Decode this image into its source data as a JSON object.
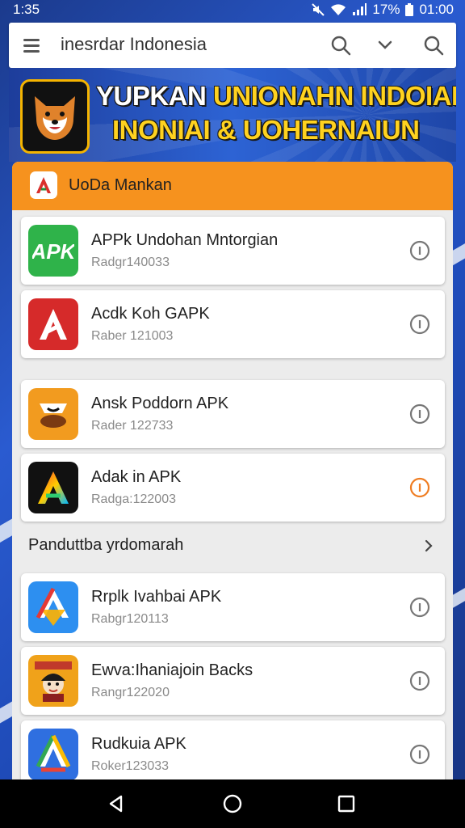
{
  "status_bar": {
    "time": "1:35",
    "battery": "17%",
    "clock_right": "01:00"
  },
  "search": {
    "query": "inesrdar Indonesia"
  },
  "banner": {
    "line1_white": "YUPKAN",
    "line1_yellow": "UNIONAHN INDOIAN",
    "line2": "INONIAI & UOHERNAIUN"
  },
  "panel": {
    "title": "UoDa Mankan"
  },
  "apps_top": [
    {
      "name": "APPk Undohan Mntorgian",
      "sub": "Radgr140033",
      "icon": "apk-green-icon"
    },
    {
      "name": "Acdk Koh GAPK",
      "sub": "Raber 121003",
      "icon": "red-a-icon"
    },
    {
      "name": "Ansk Poddorn APK",
      "sub": "Rader 122733",
      "icon": "orange-badge-icon"
    },
    {
      "name": "Adak in APK",
      "sub": "Radga:122003",
      "icon": "gradient-a-icon"
    }
  ],
  "section": {
    "title": "Panduttba yrdomarah"
  },
  "apps_bottom": [
    {
      "name": "Rrplk Ivahbai APK",
      "sub": "Rabgr120113",
      "icon": "blue-a-icon"
    },
    {
      "name": "Ewva:Ihaniajoin Backs",
      "sub": "Rangr122020",
      "icon": "character-icon"
    },
    {
      "name": "Rudkuia APK",
      "sub": "Roker123033",
      "icon": "drive-a-icon"
    }
  ],
  "colors": {
    "accent": "#f6921e",
    "banner_text": "#ffd21f",
    "bg": "#2a5bd0"
  }
}
